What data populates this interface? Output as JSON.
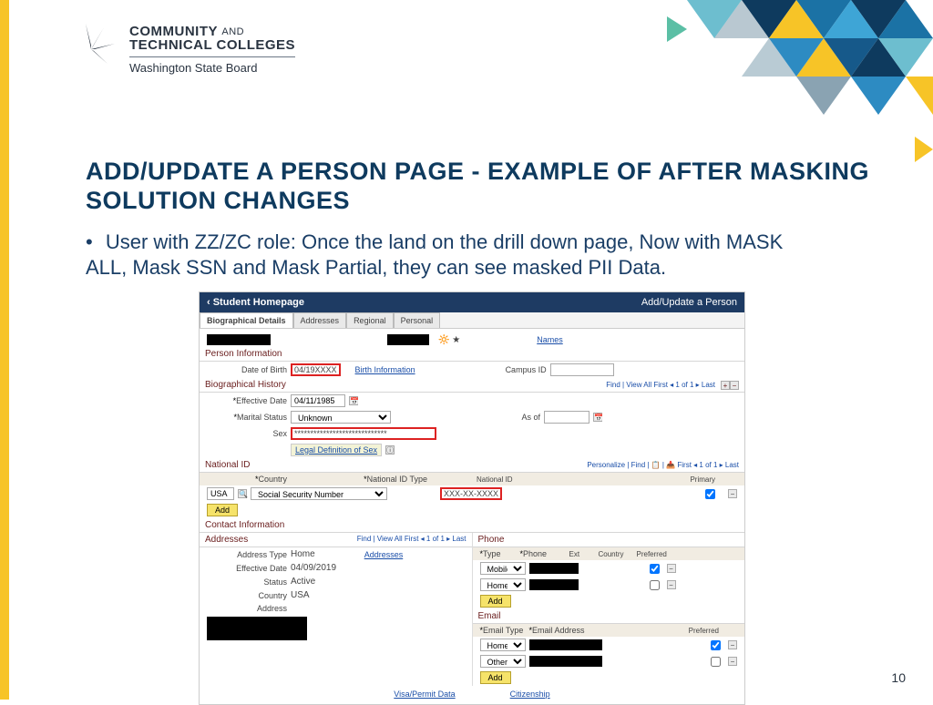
{
  "brand": {
    "line1a": "COMMUNITY",
    "line1b": "AND",
    "line2": "TECHNICAL COLLEGES",
    "line3": "Washington State Board"
  },
  "slide": {
    "title": "ADD/UPDATE A PERSON PAGE - EXAMPLE OF AFTER MASKING SOLUTION CHANGES",
    "bullet": "User with ZZ/ZC role:  Once the land on the drill down page, Now with MASK ALL, Mask SSN and Mask Partial, they can see masked PII Data.",
    "number": "10"
  },
  "shot": {
    "header_back": "‹  Student Homepage",
    "header_title": "Add/Update a Person",
    "tabs": [
      "Biographical Details",
      "Addresses",
      "Regional",
      "Personal"
    ],
    "names_link": "Names",
    "person_info": {
      "label": "Person Information",
      "dob_label": "Date of Birth",
      "dob_value": "04/19XXXX",
      "birth_info": "Birth Information",
      "campus_label": "Campus ID"
    },
    "bio_hist": {
      "label": "Biographical History",
      "nav": "Find | View All     First  ◂ 1 of 1 ▸  Last",
      "eff_date_label": "Effective Date",
      "eff_date_value": "04/11/1985",
      "marital_label": "Marital Status",
      "marital_value": "Unknown",
      "asof_label": "As of",
      "sex_label": "Sex",
      "sex_value": "*****************************",
      "legal_def": "Legal Definition of Sex"
    },
    "national": {
      "label": "National ID",
      "tools": "Personalize | Find | 📋 | 📥     First  ◂ 1 of 1 ▸  Last",
      "country_label": "Country",
      "country_value": "USA",
      "type_label": "National ID Type",
      "type_value": "Social Security Number",
      "id_label": "National ID",
      "id_value": "XXX-XX-XXXX",
      "primary_label": "Primary",
      "add": "Add"
    },
    "contact": {
      "label": "Contact Information"
    },
    "addresses": {
      "label": "Addresses",
      "nav": "Find | View All     First  ◂ 1 of 1 ▸  Last",
      "addr_type_label": "Address Type",
      "addr_type_value": "Home",
      "addresseslink": "Addresses",
      "eff_date_label": "Effective Date",
      "eff_date_value": "04/09/2019",
      "status_label": "Status",
      "status_value": "Active",
      "country_label": "Country",
      "country_value": "USA",
      "address_label": "Address"
    },
    "phone": {
      "label": "Phone",
      "cols": {
        "type": "Type",
        "phone": "Phone",
        "ext": "Ext",
        "country": "Country",
        "preferred": "Preferred"
      },
      "rows": [
        {
          "type": "Mobile",
          "preferred": true
        },
        {
          "type": "Home",
          "preferred": false
        }
      ],
      "add": "Add"
    },
    "email": {
      "label": "Email",
      "cols": {
        "type": "Email Type",
        "addr": "Email Address",
        "preferred": "Preferred"
      },
      "rows": [
        {
          "type": "Home",
          "preferred": true
        },
        {
          "type": "Other",
          "preferred": false
        }
      ],
      "add": "Add"
    },
    "footer": {
      "visa": "Visa/Permit Data",
      "citizenship": "Citizenship"
    }
  }
}
